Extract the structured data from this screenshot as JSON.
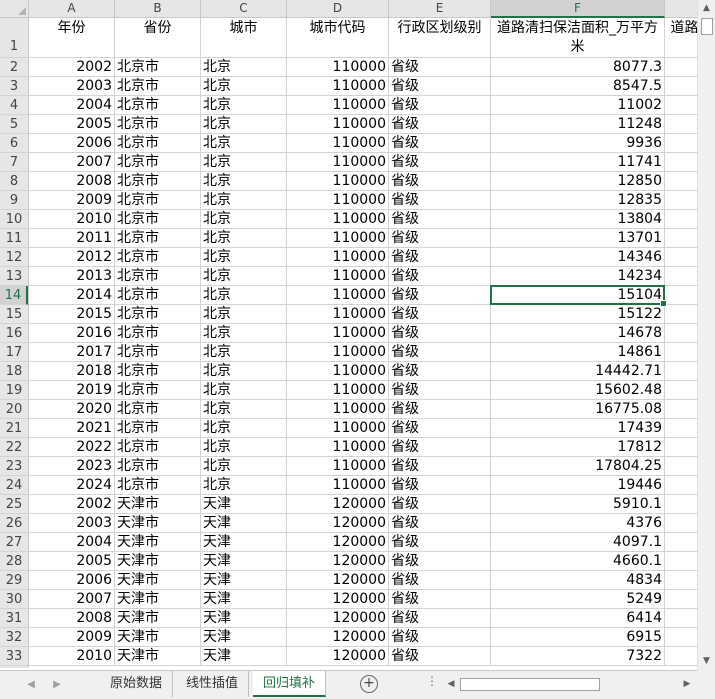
{
  "columns": [
    "A",
    "B",
    "C",
    "D",
    "E",
    "F"
  ],
  "selected_column": "F",
  "selected_row": "14",
  "header_row": {
    "row_label": "1",
    "cells": [
      "年份",
      "省份",
      "城市",
      "城市代码",
      "行政区划级别",
      "道路清扫保洁面积_万平方米",
      "道路"
    ]
  },
  "rows": [
    {
      "n": "2",
      "year": "2002",
      "prov": "北京市",
      "city": "北京",
      "code": "110000",
      "level": "省级",
      "val": "8077.3"
    },
    {
      "n": "3",
      "year": "2003",
      "prov": "北京市",
      "city": "北京",
      "code": "110000",
      "level": "省级",
      "val": "8547.5"
    },
    {
      "n": "4",
      "year": "2004",
      "prov": "北京市",
      "city": "北京",
      "code": "110000",
      "level": "省级",
      "val": "11002"
    },
    {
      "n": "5",
      "year": "2005",
      "prov": "北京市",
      "city": "北京",
      "code": "110000",
      "level": "省级",
      "val": "11248"
    },
    {
      "n": "6",
      "year": "2006",
      "prov": "北京市",
      "city": "北京",
      "code": "110000",
      "level": "省级",
      "val": "9936"
    },
    {
      "n": "7",
      "year": "2007",
      "prov": "北京市",
      "city": "北京",
      "code": "110000",
      "level": "省级",
      "val": "11741"
    },
    {
      "n": "8",
      "year": "2008",
      "prov": "北京市",
      "city": "北京",
      "code": "110000",
      "level": "省级",
      "val": "12850"
    },
    {
      "n": "9",
      "year": "2009",
      "prov": "北京市",
      "city": "北京",
      "code": "110000",
      "level": "省级",
      "val": "12835"
    },
    {
      "n": "10",
      "year": "2010",
      "prov": "北京市",
      "city": "北京",
      "code": "110000",
      "level": "省级",
      "val": "13804"
    },
    {
      "n": "11",
      "year": "2011",
      "prov": "北京市",
      "city": "北京",
      "code": "110000",
      "level": "省级",
      "val": "13701"
    },
    {
      "n": "12",
      "year": "2012",
      "prov": "北京市",
      "city": "北京",
      "code": "110000",
      "level": "省级",
      "val": "14346"
    },
    {
      "n": "13",
      "year": "2013",
      "prov": "北京市",
      "city": "北京",
      "code": "110000",
      "level": "省级",
      "val": "14234"
    },
    {
      "n": "14",
      "year": "2014",
      "prov": "北京市",
      "city": "北京",
      "code": "110000",
      "level": "省级",
      "val": "15104"
    },
    {
      "n": "15",
      "year": "2015",
      "prov": "北京市",
      "city": "北京",
      "code": "110000",
      "level": "省级",
      "val": "15122"
    },
    {
      "n": "16",
      "year": "2016",
      "prov": "北京市",
      "city": "北京",
      "code": "110000",
      "level": "省级",
      "val": "14678"
    },
    {
      "n": "17",
      "year": "2017",
      "prov": "北京市",
      "city": "北京",
      "code": "110000",
      "level": "省级",
      "val": "14861"
    },
    {
      "n": "18",
      "year": "2018",
      "prov": "北京市",
      "city": "北京",
      "code": "110000",
      "level": "省级",
      "val": "14442.71"
    },
    {
      "n": "19",
      "year": "2019",
      "prov": "北京市",
      "city": "北京",
      "code": "110000",
      "level": "省级",
      "val": "15602.48"
    },
    {
      "n": "20",
      "year": "2020",
      "prov": "北京市",
      "city": "北京",
      "code": "110000",
      "level": "省级",
      "val": "16775.08"
    },
    {
      "n": "21",
      "year": "2021",
      "prov": "北京市",
      "city": "北京",
      "code": "110000",
      "level": "省级",
      "val": "17439"
    },
    {
      "n": "22",
      "year": "2022",
      "prov": "北京市",
      "city": "北京",
      "code": "110000",
      "level": "省级",
      "val": "17812"
    },
    {
      "n": "23",
      "year": "2023",
      "prov": "北京市",
      "city": "北京",
      "code": "110000",
      "level": "省级",
      "val": "17804.25"
    },
    {
      "n": "24",
      "year": "2024",
      "prov": "北京市",
      "city": "北京",
      "code": "110000",
      "level": "省级",
      "val": "19446"
    },
    {
      "n": "25",
      "year": "2002",
      "prov": "天津市",
      "city": "天津",
      "code": "120000",
      "level": "省级",
      "val": "5910.1"
    },
    {
      "n": "26",
      "year": "2003",
      "prov": "天津市",
      "city": "天津",
      "code": "120000",
      "level": "省级",
      "val": "4376"
    },
    {
      "n": "27",
      "year": "2004",
      "prov": "天津市",
      "city": "天津",
      "code": "120000",
      "level": "省级",
      "val": "4097.1"
    },
    {
      "n": "28",
      "year": "2005",
      "prov": "天津市",
      "city": "天津",
      "code": "120000",
      "level": "省级",
      "val": "4660.1"
    },
    {
      "n": "29",
      "year": "2006",
      "prov": "天津市",
      "city": "天津",
      "code": "120000",
      "level": "省级",
      "val": "4834"
    },
    {
      "n": "30",
      "year": "2007",
      "prov": "天津市",
      "city": "天津",
      "code": "120000",
      "level": "省级",
      "val": "5249"
    },
    {
      "n": "31",
      "year": "2008",
      "prov": "天津市",
      "city": "天津",
      "code": "120000",
      "level": "省级",
      "val": "6414"
    },
    {
      "n": "32",
      "year": "2009",
      "prov": "天津市",
      "city": "天津",
      "code": "120000",
      "level": "省级",
      "val": "6915"
    },
    {
      "n": "33",
      "year": "2010",
      "prov": "天津市",
      "city": "天津",
      "code": "120000",
      "level": "省级",
      "val": "7322"
    }
  ],
  "sheet_tabs": [
    {
      "label": "原始数据",
      "active": false
    },
    {
      "label": "线性插值",
      "active": false
    },
    {
      "label": "回归填补",
      "active": true
    }
  ],
  "tab_nav": {
    "prev": "◀",
    "next": "▶",
    "add": "+",
    "more": "⋮"
  },
  "colors": {
    "accent": "#217346"
  }
}
